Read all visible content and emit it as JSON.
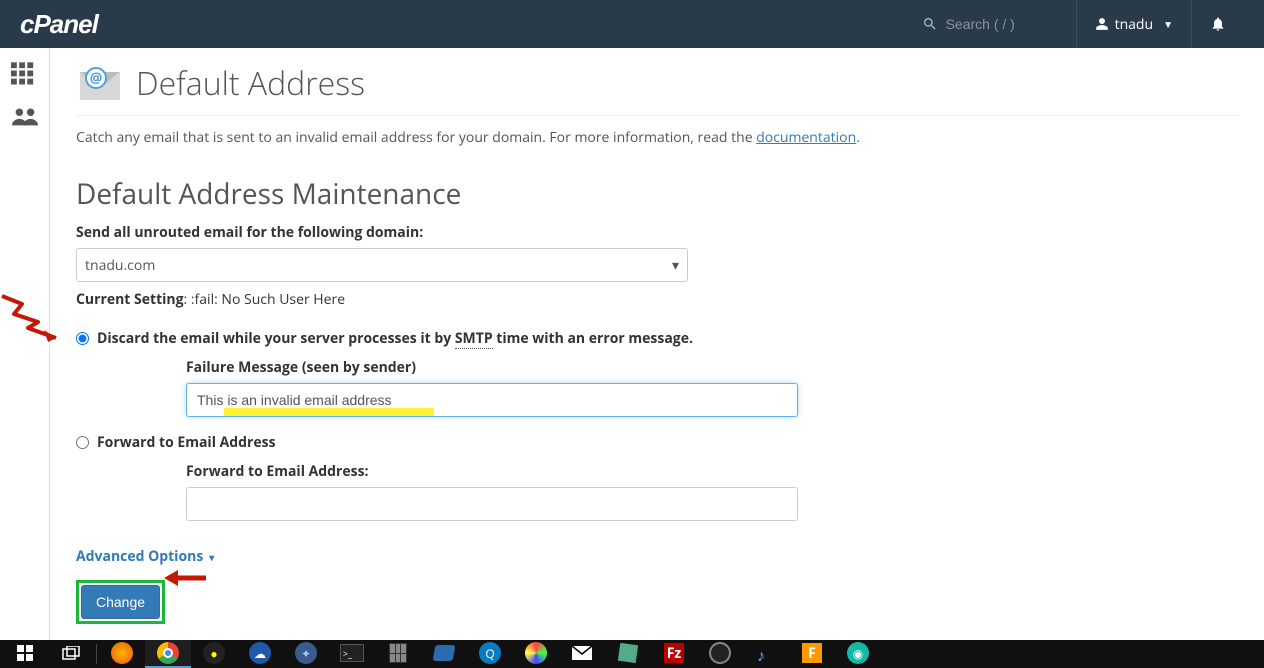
{
  "header": {
    "logo": "cPanel",
    "search_placeholder": "Search ( / )",
    "username": "tnadu"
  },
  "page": {
    "title": "Default Address",
    "intro_text": "Catch any email that is sent to an invalid email address for your domain. For more information, read the ",
    "doc_link_label": "documentation",
    "intro_suffix": "."
  },
  "section": {
    "title": "Default Address Maintenance",
    "domain_label": "Send all unrouted email for the following domain:",
    "domain_selected": "tnadu.com",
    "current_setting_label": "Current Setting",
    "current_setting_value": ": :fail: No Such User Here",
    "option_discard_prefix": "Discard the email while your server processes it by ",
    "option_discard_smtp": "SMTP",
    "option_discard_suffix": " time with an error message.",
    "failure_label": "Failure Message (seen by sender)",
    "failure_value": "This is an invalid email address",
    "option_forward": "Forward to Email Address",
    "forward_label": "Forward to Email Address:",
    "advanced_options": "Advanced Options",
    "change_button": "Change"
  }
}
